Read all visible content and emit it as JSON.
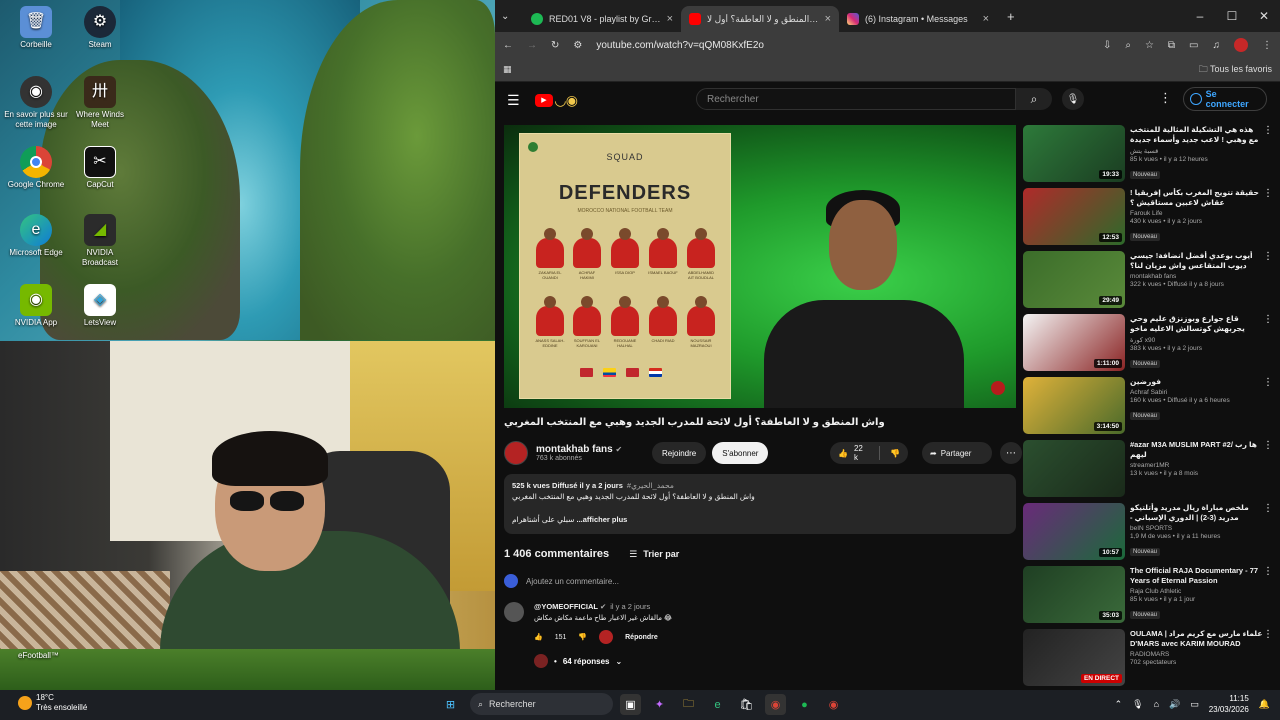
{
  "desktop": {
    "icons": [
      {
        "label": "Corbeille",
        "icon": "recycle-bin-icon",
        "color": "#5b8fd6"
      },
      {
        "label": "Steam",
        "icon": "steam-icon",
        "color": "#1b2838"
      },
      {
        "label": "En savoir plus sur cette image",
        "icon": "camera-info-icon",
        "color": "#333333"
      },
      {
        "label": "Where Winds Meet",
        "icon": "game-icon",
        "color": "#3a2a1a"
      },
      {
        "label": "Google Chrome",
        "icon": "chrome-icon",
        "color": "#db4437"
      },
      {
        "label": "CapCut",
        "icon": "capcut-icon",
        "color": "#111111"
      },
      {
        "label": "Microsoft Edge",
        "icon": "edge-icon",
        "color": "#0f7bd6"
      },
      {
        "label": "NVIDIA Broadcast",
        "icon": "nvidia-broadcast-icon",
        "color": "#2b2b2b"
      },
      {
        "label": "NVIDIA App",
        "icon": "nvidia-icon",
        "color": "#76b900"
      },
      {
        "label": "LetsView",
        "icon": "letsview-icon",
        "color": "#2fa3d9"
      }
    ],
    "efootball": "eFootball™"
  },
  "browser": {
    "tabs": [
      {
        "title": "RED01 V8 - playlist by Greenbo",
        "icon": "spotify-icon",
        "color": "#1db954",
        "active": false
      },
      {
        "title": "واش المنطق و لا العاطفة؟ أول لا",
        "icon": "youtube-icon",
        "color": "#ff0000",
        "active": true
      },
      {
        "title": "(6) Instagram • Messages",
        "icon": "instagram-icon",
        "color": "#d62976",
        "active": false
      }
    ],
    "url": "youtube.com/watch?v=qQM08KxfE2o",
    "bookmarks_label": "Tous les favoris"
  },
  "youtube": {
    "search_placeholder": "Rechercher",
    "signin": "Se connecter",
    "video": {
      "card_squad": "SQUAD",
      "card_title": "DEFENDERS",
      "card_subtitle": "MOROCCO NATIONAL FOOTBALL TEAM",
      "players": [
        {
          "name": "ZAKARIA EL OUANDI"
        },
        {
          "name": "ACHRAF HAKIMI"
        },
        {
          "name": "ISSA DIOP"
        },
        {
          "name": "ISMAEL BAOUF"
        },
        {
          "name": "ABDELHAMID AIT BOUDLAL"
        },
        {
          "name": "ANASS SALAH-EDDINE"
        },
        {
          "name": "SOUFFIAN EL KAROUANI"
        },
        {
          "name": "REDOUANE HALHAL"
        },
        {
          "name": "CHADI RIAD"
        },
        {
          "name": "NOUSSAIR MAZRAOUI"
        }
      ],
      "title": "واش المنطق و لا العاطفة؟ أول لائحة للمدرب الجديد وهبي مع المنتخب المغربي",
      "channel": "montakhab fans",
      "subscribers": "763 k abonnés",
      "join": "Rejoindre",
      "subscribe": "S'abonner",
      "likes": "22 k",
      "share": "Partager",
      "desc_stats": "525 k vues  Diffusé il y a 2 jours",
      "desc_tag": "#محمد_الحيري",
      "desc_line1": "واش المنطق و لا العاطفة؟ أول لائحة للمدرب الجديد وهبي مع المنتخب المغربي",
      "desc_line2": "سبلي على أشتاهرام",
      "desc_more": "...afficher plus"
    },
    "comments": {
      "count": "1 406 commentaires",
      "sort": "Trier par",
      "add": "Ajoutez un commentaire...",
      "first": {
        "author": "@YOMEOFFICIAL",
        "time": "il y a 2 jours",
        "text": "مالقاش غير الاعبار طاح ماعمة مكاش مكاش 😂",
        "likes": "151",
        "reply": "Répondre"
      },
      "replies": "64 réponses"
    },
    "recommendations": [
      {
        "title": "هذه هي التشكيلة المثالية للمنتخب مع وهبي ! لاعب جديد وأسماء جديدة تدخل بقوة",
        "channel": "قسبة يتش",
        "meta": "85 k vues • il y a 12 heures",
        "new": "Nouveau",
        "duration": "19:33",
        "thumb": "#2d7a3a"
      },
      {
        "title": "حقيقة تتويج المغرب بكأس إفريقيا ! عقاش لاعبين مستاقيش ؟",
        "channel": "Farouk Life",
        "meta": "430 k vues • il y a 2 jours",
        "new": "Nouveau",
        "duration": "12:53",
        "thumb": "#b02a2a"
      },
      {
        "title": "أيوب بوعدي أفضل انضافة! جيسي ديوب المتقاعس واش مزيان لنا؟",
        "channel": "montakhab fans",
        "meta": "322 k vues • Diffusé il y a 8 jours",
        "new": "",
        "duration": "29:49",
        "thumb": "#3b6d2a"
      },
      {
        "title": "قاع جوارع وبوزنزق عليم وحي يجربهش كوتسالش الاعليه ماخو الحريشات",
        "channel": "كورة x90",
        "meta": "383 k vues • il y a 2 jours",
        "new": "Nouveau",
        "duration": "1:11:00",
        "thumb": "#8a2424"
      },
      {
        "title": "فورضين",
        "channel": "Achraf Sabiri",
        "meta": "160 k vues • Diffusé il y a 6 heures",
        "new": "Nouveau",
        "duration": "3:14:50",
        "thumb": "#4a6a2a"
      },
      {
        "title": "#azar M3A MUSLIM PART #2/ ها رب ليهم",
        "channel": "streamer1MR",
        "meta": "13 k vues • il y a 8 mois",
        "new": "",
        "duration": "",
        "thumb": "#2b4f2f"
      },
      {
        "title": "ملخص مباراة ريال مدريد وأتلتيكو مدريد (3-2) | الدوري الإسباني - الجولة 29",
        "channel": "beIN SPORTS",
        "meta": "1,9 M de vues • il y a 11 heures",
        "new": "Nouveau",
        "duration": "10:57",
        "thumb": "#6a2a7a"
      },
      {
        "title": "The Official RAJA Documentary - 77 Years of Eternal Passion",
        "channel": "Raja Club Athletic",
        "meta": "85 k vues • il y a 1 jour",
        "new": "Nouveau",
        "duration": "35:03",
        "thumb": "#1f3f23"
      },
      {
        "title": "OULAMA | علماء مارس مع كريم مراد D'MARS avec KARIM MOURAD",
        "channel": "RADIOMARS",
        "meta": "702 spectateurs",
        "new": "",
        "duration": "EN DIRECT",
        "thumb": "#222222"
      }
    ]
  },
  "taskbar": {
    "temp": "18°C",
    "weather": "Très ensoleillé",
    "search": "Rechercher",
    "time": "11:15",
    "date": "23/03/2026"
  }
}
